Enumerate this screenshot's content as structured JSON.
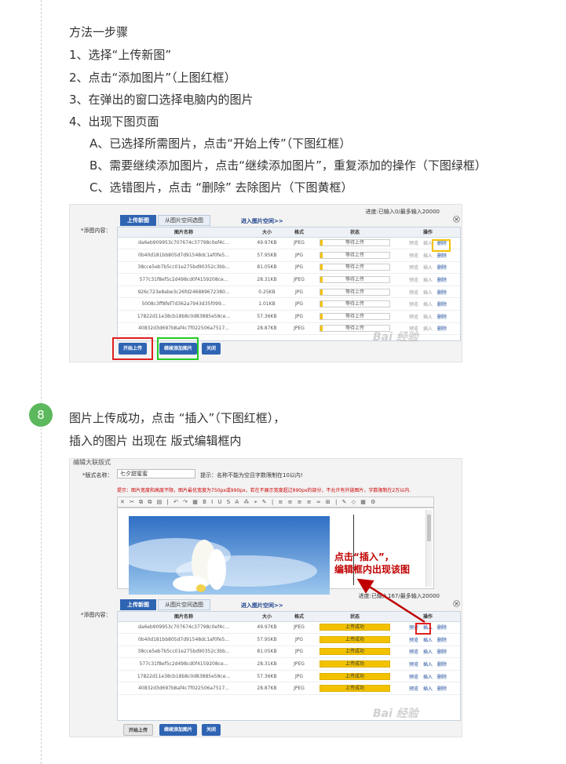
{
  "intro": {
    "heading": "方法一步骤",
    "steps": [
      "1、选择“上传新图”",
      "2、点击“添加图片”（上图红框）",
      "3、在弹出的窗口选择电脑内的图片",
      "4、出现下图页面"
    ],
    "substeps": [
      "A、已选择所需图片，点击“开始上传”（下图红框）",
      "B、需要继续添加图片，点击“继续添加图片”，重复添加的操作（下图绿框）",
      "C、选错图片，点击 “删除” 去除图片（下图黄框）"
    ]
  },
  "step8": {
    "number": "8",
    "line1": "图片上传成功，点击 “插入”（下图红框），",
    "line2": "插入的图片 出现在 版式编辑框内"
  },
  "shot1": {
    "status": "进度:已输入0/最多输入20000",
    "field_label": "*添图内容：",
    "tab_new": "上传新图",
    "tab_space": "从图片空间选图",
    "enter_space": "进入图片空间>>",
    "columns": [
      "图片名称",
      "大小",
      "格式",
      "状态",
      "操作"
    ],
    "rows": [
      {
        "name": "da6eb909953c707674c37798c0ef4c...",
        "size": "49.97KB",
        "fmt": "JPEG"
      },
      {
        "name": "0b40d181bb805d7d91548dc1af0fe5...",
        "size": "57.95KB",
        "fmt": "JPG"
      },
      {
        "name": "38cce5eb7b5cc01e275bd90352c3bb...",
        "size": "81.05KB",
        "fmt": "JPG"
      },
      {
        "name": "577c31f8ef5c2d498cd0f4159208ce...",
        "size": "28.31KB",
        "fmt": "JPEG"
      },
      {
        "name": "926c723e8abe3c26fd246889672380...",
        "size": "0.25KB",
        "fmt": "JPG"
      },
      {
        "name": "5008c3ff8fef7d362a7943d35f099...",
        "size": "1.01KB",
        "fmt": "JPG"
      },
      {
        "name": "17822d11e38cb18b8c0d83885e58ce...",
        "size": "57.36KB",
        "fmt": "JPG"
      },
      {
        "name": "40832d3d697b8af4c7f022506a7517...",
        "size": "28.87KB",
        "fmt": "JPEG"
      }
    ],
    "status_wait": "等待上传",
    "op_preview": "预览",
    "op_insert": "插入",
    "op_delete": "删除",
    "btn_start": "开始上传",
    "btn_add": "继续添加图片",
    "btn_close": "关闭",
    "watermark": "Bai 经验"
  },
  "shot2": {
    "top_label": "编辑大联版式",
    "name_label": "*版式名称：",
    "name_value": "七夕甜蜜蜜",
    "name_hint": "提示：名称不能为空且字数限制在10以内!",
    "tip": "提示：图片宽度和高度不限，图片最优宽度为750px或990px，若在不展示宽度超过990px的部分，不允许有外链图片，字数限制在2万以内.",
    "annotation1": "点击“插入”，",
    "annotation2": "编辑框内出现该图",
    "status": "进度:已输入167/最多输入20000",
    "field_label": "*添图内容：",
    "tab_new": "上传新图",
    "tab_space": "从图片空间选图",
    "enter_space": "进入图片空间>>",
    "columns": [
      "图片名称",
      "大小",
      "格式",
      "状态",
      "操作"
    ],
    "rows": [
      {
        "name": "da6eb909953c707674c37798c0ef4c...",
        "size": "49.97KB",
        "fmt": "JPEG"
      },
      {
        "name": "0b40d181bb805d7d91548dc1af0fe5...",
        "size": "57.95KB",
        "fmt": "JPG"
      },
      {
        "name": "38cce5eb7b5cc01e275bd90352c3bb...",
        "size": "81.05KB",
        "fmt": "JPG"
      },
      {
        "name": "577c31f8ef5c2d498cd0f4159208ce...",
        "size": "28.31KB",
        "fmt": "JPEG"
      },
      {
        "name": "17822d11e38cb18b8c0d83885e58ce...",
        "size": "57.36KB",
        "fmt": "JPG"
      },
      {
        "name": "40832d3d697b8af4c7f022506a7517...",
        "size": "28.87KB",
        "fmt": "JPEG"
      }
    ],
    "status_done": "上传成功",
    "op_preview": "预览",
    "op_insert": "插入",
    "op_delete": "删除",
    "btn_start": "开始上传",
    "btn_add": "继续添加图片",
    "btn_close": "关闭",
    "watermark": "Bai 经验"
  },
  "colors": {
    "accent": "#2f64b3",
    "badge": "#5cb85c",
    "red_frame": "#e02020",
    "green_frame": "#22cc22",
    "yellow_frame": "#f2c200"
  }
}
